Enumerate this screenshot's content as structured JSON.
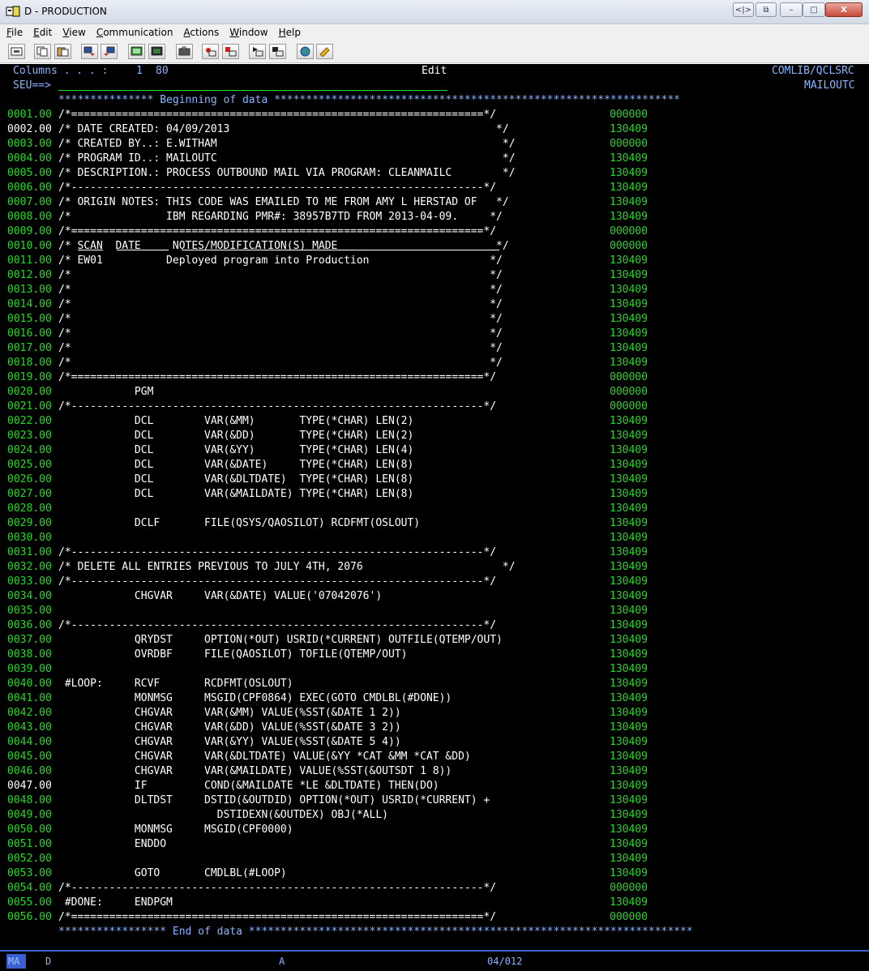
{
  "window": {
    "title": "D - PRODUCTION",
    "nav_glyph": "<|>",
    "restore2_glyph": "⧉",
    "min_glyph": "–",
    "max_glyph": "□",
    "close_glyph": "X"
  },
  "menu": [
    "File",
    "Edit",
    "View",
    "Communication",
    "Actions",
    "Window",
    "Help"
  ],
  "toolbar": {
    "icons": [
      "print-screen-icon",
      "copy-icon",
      "paste-icon",
      "send-icon",
      "receive-icon",
      "display-icon",
      "keypad-icon",
      "macro-icon",
      "record-icon",
      "stop-icon",
      "play-icon",
      "play-macro-icon",
      "globe-icon",
      "help-icon"
    ]
  },
  "header": {
    "columns_label": "Columns . . . :",
    "columns_from": "1",
    "columns_to": "80",
    "mode": "Edit",
    "library_file": "COMLIB/QCLSRC",
    "seu_prompt": "SEU==>",
    "member": "MAILOUTC"
  },
  "banners": {
    "begin": "*************** Beginning of data ****************************************************************",
    "end": "***************** End of data **********************************************************************"
  },
  "lines": [
    {
      "seq": "0001.00",
      "text": "/*=================================================================*/",
      "date": "000000"
    },
    {
      "seq": "0002.00",
      "text": "/* DATE CREATED: 04/09/2013                                          */",
      "date": "130409"
    },
    {
      "seq": "0003.00",
      "text": "/* CREATED BY..: E.WITHAM                                             */",
      "date": "000000"
    },
    {
      "seq": "0004.00",
      "text": "/* PROGRAM ID..: MAILOUTC                                             */",
      "date": "130409"
    },
    {
      "seq": "0005.00",
      "text": "/* DESCRIPTION.: PROCESS OUTBOUND MAIL VIA PROGRAM: CLEANMAILC        */",
      "date": "130409"
    },
    {
      "seq": "0006.00",
      "text": "/*-----------------------------------------------------------------*/",
      "date": "130409"
    },
    {
      "seq": "0007.00",
      "text": "/* ORIGIN NOTES: THIS CODE WAS EMAILED TO ME FROM AMY L HERSTAD OF   */",
      "date": "130409"
    },
    {
      "seq": "0008.00",
      "text": "/*               IBM REGARDING PMR#: 38957B7TD FROM 2013-04-09.     */",
      "date": "130409"
    },
    {
      "seq": "0009.00",
      "text": "/*=================================================================*/",
      "date": "000000"
    },
    {
      "seq": "0010.00",
      "text": "/* SCAN  DATE     NOTES/MODIFICATION(S) MADE                         */",
      "date": "000000"
    },
    {
      "seq": "0011.00",
      "text": "/* EW01          Deployed program into Production                   */",
      "date": "130409"
    },
    {
      "seq": "0012.00",
      "text": "/*                                                                  */",
      "date": "130409"
    },
    {
      "seq": "0013.00",
      "text": "/*                                                                  */",
      "date": "130409"
    },
    {
      "seq": "0014.00",
      "text": "/*                                                                  */",
      "date": "130409"
    },
    {
      "seq": "0015.00",
      "text": "/*                                                                  */",
      "date": "130409"
    },
    {
      "seq": "0016.00",
      "text": "/*                                                                  */",
      "date": "130409"
    },
    {
      "seq": "0017.00",
      "text": "/*                                                                  */",
      "date": "130409"
    },
    {
      "seq": "0018.00",
      "text": "/*                                                                  */",
      "date": "130409"
    },
    {
      "seq": "0019.00",
      "text": "/*=================================================================*/",
      "date": "000000"
    },
    {
      "seq": "0020.00",
      "text": "            PGM",
      "date": "000000"
    },
    {
      "seq": "0021.00",
      "text": "/*-----------------------------------------------------------------*/",
      "date": "000000"
    },
    {
      "seq": "0022.00",
      "text": "            DCL        VAR(&MM)       TYPE(*CHAR) LEN(2)",
      "date": "130409"
    },
    {
      "seq": "0023.00",
      "text": "            DCL        VAR(&DD)       TYPE(*CHAR) LEN(2)",
      "date": "130409"
    },
    {
      "seq": "0024.00",
      "text": "            DCL        VAR(&YY)       TYPE(*CHAR) LEN(4)",
      "date": "130409"
    },
    {
      "seq": "0025.00",
      "text": "            DCL        VAR(&DATE)     TYPE(*CHAR) LEN(8)",
      "date": "130409"
    },
    {
      "seq": "0026.00",
      "text": "            DCL        VAR(&DLTDATE)  TYPE(*CHAR) LEN(8)",
      "date": "130409"
    },
    {
      "seq": "0027.00",
      "text": "            DCL        VAR(&MAILDATE) TYPE(*CHAR) LEN(8)",
      "date": "130409"
    },
    {
      "seq": "0028.00",
      "text": "",
      "date": "130409"
    },
    {
      "seq": "0029.00",
      "text": "            DCLF       FILE(QSYS/QAOSILOT) RCDFMT(OSLOUT)",
      "date": "130409"
    },
    {
      "seq": "0030.00",
      "text": "",
      "date": "130409"
    },
    {
      "seq": "0031.00",
      "text": "/*-----------------------------------------------------------------*/",
      "date": "130409"
    },
    {
      "seq": "0032.00",
      "text": "/* DELETE ALL ENTRIES PREVIOUS TO JULY 4TH, 2076                      */",
      "date": "130409"
    },
    {
      "seq": "0033.00",
      "text": "/*-----------------------------------------------------------------*/",
      "date": "130409"
    },
    {
      "seq": "0034.00",
      "text": "            CHGVAR     VAR(&DATE) VALUE('07042076')",
      "date": "130409"
    },
    {
      "seq": "0035.00",
      "text": "",
      "date": "130409"
    },
    {
      "seq": "0036.00",
      "text": "/*-----------------------------------------------------------------*/",
      "date": "130409"
    },
    {
      "seq": "0037.00",
      "text": "            QRYDST     OPTION(*OUT) USRID(*CURRENT) OUTFILE(QTEMP/OUT)",
      "date": "130409"
    },
    {
      "seq": "0038.00",
      "text": "            OVRDBF     FILE(QAOSILOT) TOFILE(QTEMP/OUT)",
      "date": "130409"
    },
    {
      "seq": "0039.00",
      "text": "",
      "date": "130409"
    },
    {
      "seq": "0040.00",
      "text": " #LOOP:     RCVF       RCDFMT(OSLOUT)",
      "date": "130409"
    },
    {
      "seq": "0041.00",
      "text": "            MONMSG     MSGID(CPF0864) EXEC(GOTO CMDLBL(#DONE))",
      "date": "130409"
    },
    {
      "seq": "0042.00",
      "text": "            CHGVAR     VAR(&MM) VALUE(%SST(&DATE 1 2))",
      "date": "130409"
    },
    {
      "seq": "0043.00",
      "text": "            CHGVAR     VAR(&DD) VALUE(%SST(&DATE 3 2))",
      "date": "130409"
    },
    {
      "seq": "0044.00",
      "text": "            CHGVAR     VAR(&YY) VALUE(%SST(&DATE 5 4))",
      "date": "130409"
    },
    {
      "seq": "0045.00",
      "text": "            CHGVAR     VAR(&DLTDATE) VALUE(&YY *CAT &MM *CAT &DD)",
      "date": "130409"
    },
    {
      "seq": "0046.00",
      "text": "            CHGVAR     VAR(&MAILDATE) VALUE(%SST(&OUTSDT 1 8))",
      "date": "130409"
    },
    {
      "seq": "0047.00",
      "text": "            IF         COND(&MAILDATE *LE &DLTDATE) THEN(DO)",
      "date": "130409"
    },
    {
      "seq": "0048.00",
      "text": "            DLTDST     DSTID(&OUTDID) OPTION(*OUT) USRID(*CURRENT) +",
      "date": "130409"
    },
    {
      "seq": "0049.00",
      "text": "                         DSTIDEXN(&OUTDEX) OBJ(*ALL)",
      "date": "130409"
    },
    {
      "seq": "0050.00",
      "text": "            MONMSG     MSGID(CPF0000)",
      "date": "130409"
    },
    {
      "seq": "0051.00",
      "text": "            ENDDO",
      "date": "130409"
    },
    {
      "seq": "0052.00",
      "text": "",
      "date": "130409"
    },
    {
      "seq": "0053.00",
      "text": "            GOTO       CMDLBL(#LOOP)",
      "date": "130409"
    },
    {
      "seq": "0054.00",
      "text": "/*-----------------------------------------------------------------*/",
      "date": "000000"
    },
    {
      "seq": "0055.00",
      "text": " #DONE:     ENDPGM",
      "date": "130409"
    },
    {
      "seq": "0056.00",
      "text": "/*=================================================================*/",
      "date": "000000"
    }
  ],
  "status": {
    "mode": "MA",
    "session": "D",
    "insert": "A",
    "cursor": "04/012"
  }
}
